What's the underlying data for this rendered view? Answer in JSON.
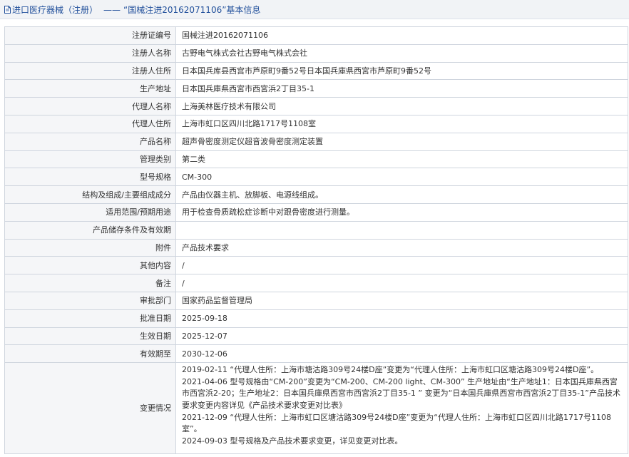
{
  "header": {
    "section": "进口医疗器械（注册）",
    "separator": "——",
    "title": "“国械注进20162071106”基本信息"
  },
  "rows": [
    {
      "label": "注册证编号",
      "value": "国械注进20162071106"
    },
    {
      "label": "注册人名称",
      "value": "古野电气株式会社古野电气株式会社"
    },
    {
      "label": "注册人住所",
      "value": "日本国兵库县西宫市芦原町9番52号日本国兵庫県西宮市芦原町9番52号"
    },
    {
      "label": "生产地址",
      "value": "日本国兵庫県西宮市西宮浜2丁目35-1"
    },
    {
      "label": "代理人名称",
      "value": "上海美林医疗技术有限公司"
    },
    {
      "label": "代理人住所",
      "value": "上海市虹口区四川北路1717号1108室"
    },
    {
      "label": "产品名称",
      "value": "超声骨密度测定仪超音波骨密度测定装置"
    },
    {
      "label": "管理类别",
      "value": "第二类"
    },
    {
      "label": "型号规格",
      "value": "CM-300"
    },
    {
      "label": "结构及组成/主要组成成分",
      "value": "产品由仪器主机、放脚板、电源线组成。"
    },
    {
      "label": "适用范围/预期用途",
      "value": "用于检查骨质疏松症诊断中对跟骨密度进行测量。"
    },
    {
      "label": "产品储存条件及有效期",
      "value": ""
    },
    {
      "label": "附件",
      "value": "产品技术要求"
    },
    {
      "label": "其他内容",
      "value": "/"
    },
    {
      "label": "备注",
      "value": "/"
    },
    {
      "label": "审批部门",
      "value": "国家药品监督管理局"
    },
    {
      "label": "批准日期",
      "value": "2025-09-18"
    },
    {
      "label": "生效日期",
      "value": "2025-12-07"
    },
    {
      "label": "有效期至",
      "value": "2030-12-06"
    }
  ],
  "change_log": {
    "label": "变更情况",
    "entries": [
      "2019-02-11 “代理人住所：上海市塘沽路309号24楼D座”变更为“代理人住所：上海市虹口区塘沽路309号24楼D座”。",
      "2021-04-06 型号规格由“CM-200”变更为“CM-200、CM-200 light、CM-300” 生产地址由“生产地址1：日本国兵庫県西宮市西宮浜2-20；生产地址2：日本国兵庫県西宮市西宮浜2丁目35-1 ” 变更为“日本国兵庫県西宮市西宮浜2丁目35-1”产品技术要求变更内容详见《产品技术要求变更对比表》",
      "2021-12-09 “代理人住所：上海市虹口区塘沽路309号24楼D座”变更为“代理人住所：上海市虹口区四川北路1717号1108室”。",
      "2024-09-03 型号规格及产品技术要求变更，详见变更对比表。"
    ]
  }
}
